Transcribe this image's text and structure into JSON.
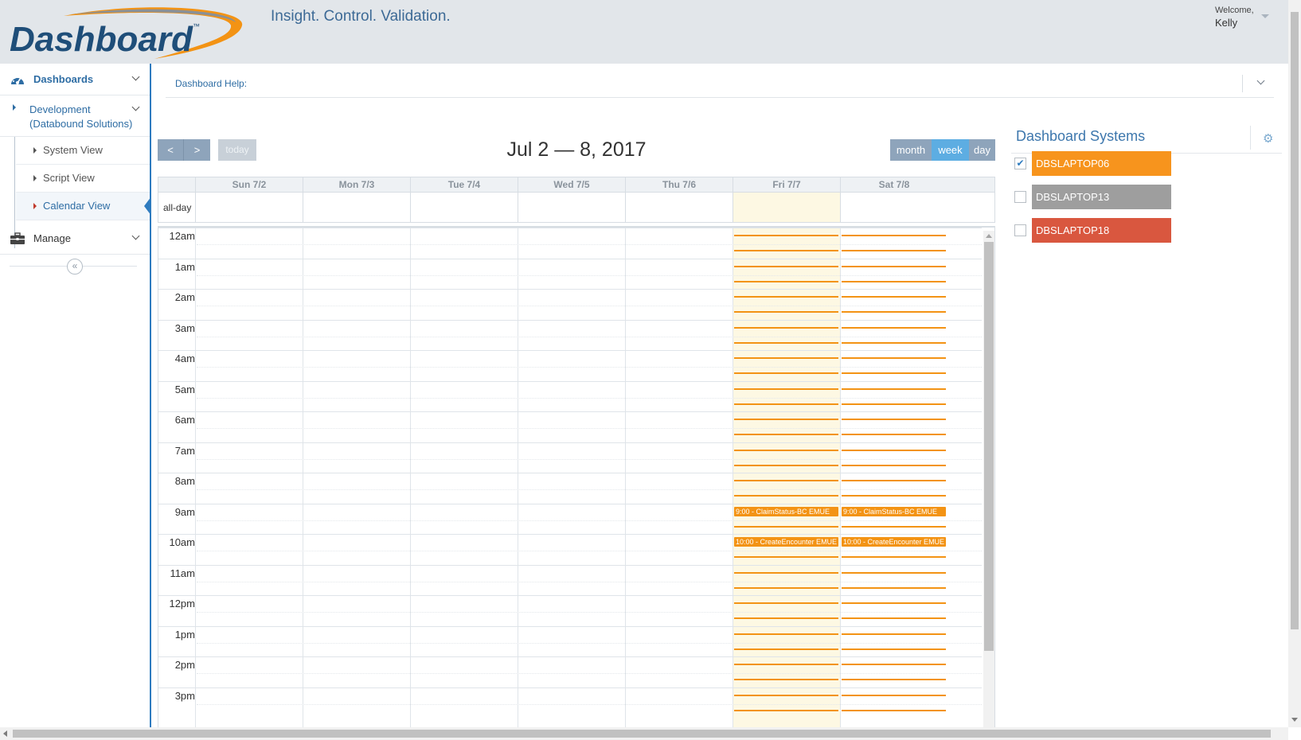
{
  "app": {
    "logo_text": "Dashboard",
    "logo_tm": "™",
    "tagline": "Insight. Control. Validation.",
    "welcome_label": "Welcome,",
    "user_name": "Kelly"
  },
  "sidebar": {
    "dashboards_label": "Dashboards",
    "development_line1": "Development",
    "development_line2": "(Databound Solutions)",
    "sub_items": [
      {
        "label": "System View"
      },
      {
        "label": "Script View"
      },
      {
        "label": "Calendar View",
        "active": true
      }
    ],
    "manage_label": "Manage",
    "collapse_glyph": "«"
  },
  "help": {
    "label": "Dashboard Help:"
  },
  "calendar": {
    "title": "Jul 2 — 8, 2017",
    "prev_glyph": "<",
    "next_glyph": ">",
    "today_label": "today",
    "views": {
      "month": "month",
      "week": "week",
      "day": "day"
    },
    "active_view": "week",
    "allday_label": "all-day",
    "days": [
      "Sun 7/2",
      "Mon 7/3",
      "Tue 7/4",
      "Wed 7/5",
      "Thu 7/6",
      "Fri 7/7",
      "Sat 7/8"
    ],
    "today_index": 5,
    "hours": [
      "12am",
      "1am",
      "2am",
      "3am",
      "4am",
      "5am",
      "6am",
      "7am",
      "8am",
      "9am",
      "10am",
      "11am",
      "12pm",
      "1pm",
      "2pm",
      "3pm"
    ],
    "event_days": [
      5,
      6
    ],
    "event_color": "#f39314",
    "events": [
      {
        "hour": 9,
        "text": "9:00 - ClaimStatus-BC EMUE"
      },
      {
        "hour": 10,
        "text": "10:00 - CreateEncounter EMUE"
      }
    ]
  },
  "systems": {
    "title": "Dashboard Systems",
    "items": [
      {
        "name": "DBSLAPTOP06",
        "checked": true,
        "color": "#f7941d"
      },
      {
        "name": "DBSLAPTOP13",
        "checked": false,
        "color": "#9e9e9e"
      },
      {
        "name": "DBSLAPTOP18",
        "checked": false,
        "color": "#d9573f"
      }
    ]
  },
  "colors": {
    "accent": "#2e7bbf",
    "header_bg": "#e2e6ea",
    "toolbar_btn": "#8ea4bb",
    "active_view_btn": "#5dade2",
    "today_column": "#fdf8e3"
  }
}
